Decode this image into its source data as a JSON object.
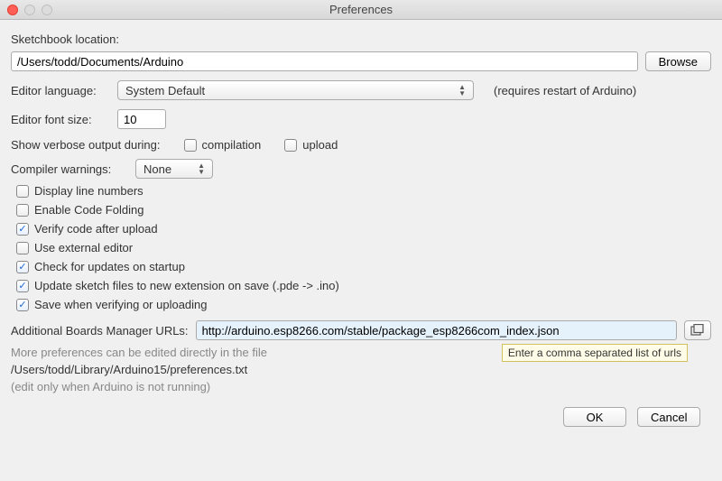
{
  "window": {
    "title": "Preferences"
  },
  "sketchbook": {
    "label": "Sketchbook location:",
    "path": "/Users/todd/Documents/Arduino",
    "browse": "Browse"
  },
  "language": {
    "label": "Editor language:",
    "value": "System Default",
    "note": "(requires restart of Arduino)"
  },
  "fontsize": {
    "label": "Editor font size:",
    "value": "10"
  },
  "verbose": {
    "label": "Show verbose output during:",
    "compilation_label": "compilation",
    "compilation_checked": false,
    "upload_label": "upload",
    "upload_checked": false
  },
  "warnings": {
    "label": "Compiler warnings:",
    "value": "None"
  },
  "options": {
    "line_numbers": {
      "label": "Display line numbers",
      "checked": false
    },
    "code_folding": {
      "label": "Enable Code Folding",
      "checked": false
    },
    "verify_upload": {
      "label": "Verify code after upload",
      "checked": true
    },
    "external_editor": {
      "label": "Use external editor",
      "checked": false
    },
    "check_updates": {
      "label": "Check for updates on startup",
      "checked": true
    },
    "update_ext": {
      "label": "Update sketch files to new extension on save (.pde -> .ino)",
      "checked": true
    },
    "save_on_verify": {
      "label": "Save when verifying or uploading",
      "checked": true
    }
  },
  "boards_urls": {
    "label": "Additional Boards Manager URLs:",
    "value": "http://arduino.esp8266.com/stable/package_esp8266com_index.json",
    "tooltip": "Enter a comma separated list of urls"
  },
  "more": {
    "line1": "More preferences can be edited directly in the file",
    "path": "/Users/todd/Library/Arduino15/preferences.txt",
    "line3": "(edit only when Arduino is not running)"
  },
  "buttons": {
    "ok": "OK",
    "cancel": "Cancel"
  }
}
